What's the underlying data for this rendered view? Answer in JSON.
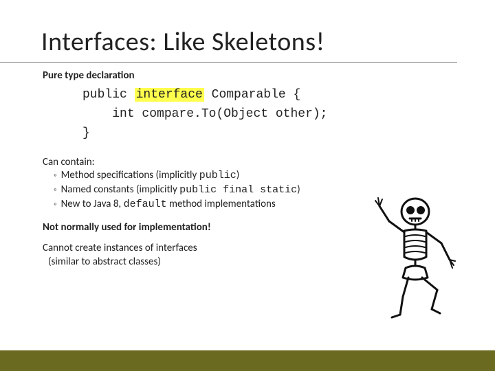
{
  "title": "Interfaces: Like Skeletons!",
  "pureDecl": "Pure type declaration",
  "code": {
    "kw_public": "public",
    "kw_interface": "interface",
    "classname": "Comparable",
    "brace_open": "{",
    "method_line": "int compare.To(Object other);",
    "brace_close": "}"
  },
  "canContain": "Can contain:",
  "bullets": [
    {
      "pre": "Method specifications (implicitly ",
      "mono": "public",
      "post": ")"
    },
    {
      "pre": "Named constants (implicitly ",
      "mono": "public final static",
      "post": ")"
    },
    {
      "pre": "New to Java 8, ",
      "mono": "default",
      "post": " method implementations"
    }
  ],
  "notUsed": "Not normally used for implementation!",
  "cannotCreate1": "Cannot create instances of interfaces",
  "cannotCreate2": "(similar to abstract classes)",
  "bulletGlyph": "◦",
  "skeletonAlt": "skeleton-cartoon"
}
